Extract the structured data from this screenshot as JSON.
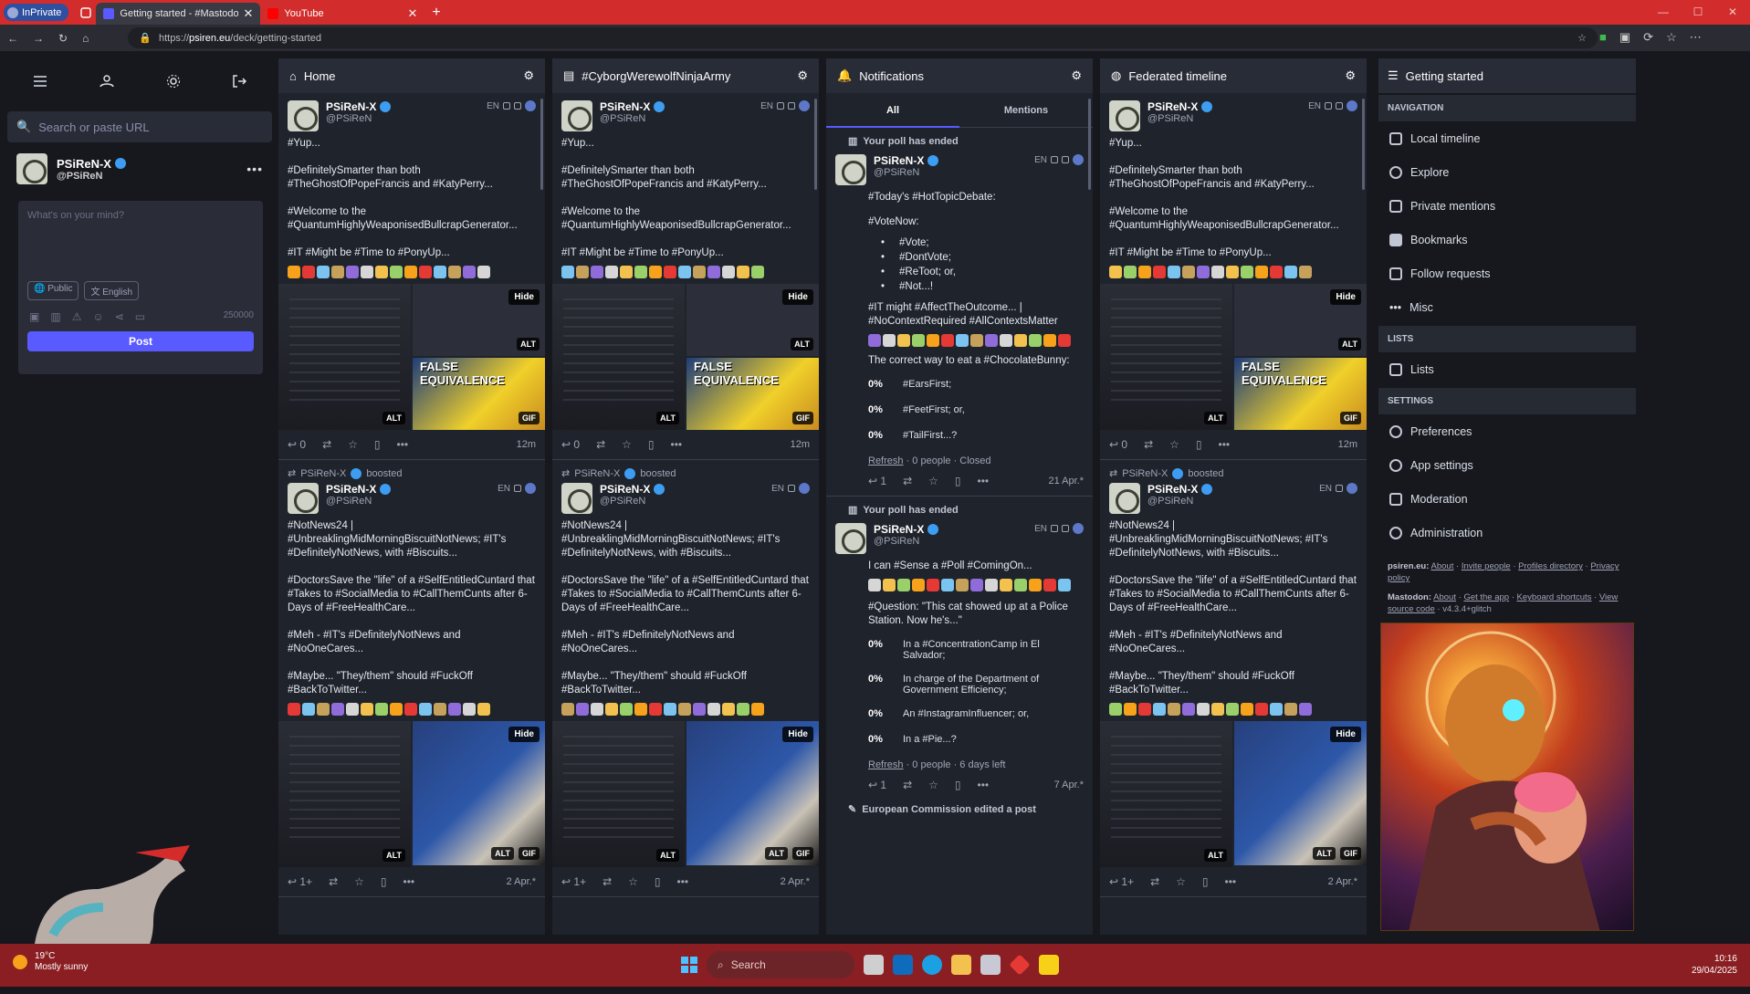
{
  "browser": {
    "inprivate": "InPrivate",
    "tabs": [
      {
        "title": "Getting started - #MastodonSpy",
        "active": true,
        "color": "#595aff"
      },
      {
        "title": "YouTube",
        "active": false,
        "color": "#ff0000"
      }
    ],
    "url_host": "psiren.eu",
    "url_prefix": "https://",
    "url_path": "/deck/getting-started"
  },
  "drawer": {
    "search_placeholder": "Search or paste URL",
    "account": {
      "name": "PSiReN-X",
      "acct": "@PSiReN"
    },
    "compose": {
      "placeholder": "What's on your mind?",
      "visibility": "Public",
      "language": "English",
      "counter": "250000",
      "post_label": "Post"
    }
  },
  "columns": [
    {
      "title": "Home",
      "icon": "home-icon"
    },
    {
      "title": "#CyborgWerewolfNinjaArmy",
      "icon": "hashtag-icon"
    },
    {
      "title": "Notifications",
      "icon": "bell-icon"
    },
    {
      "title": "Federated timeline",
      "icon": "globe-icon"
    }
  ],
  "status1": {
    "name": "PSiReN-X",
    "acct": "@PSiReN",
    "lang": "EN",
    "lines": [
      "#Yup...",
      "#DefinitelySmarter than both #TheGhostOfPopeFrancis and #KatyPerry...",
      "#Welcome to the #QuantumHighlyWeaponisedBullcrapGenerator...",
      "#IT #Might be #Time to #PonyUp..."
    ],
    "media_hide": "Hide",
    "alt": "ALT",
    "gif": "GIF",
    "meme_text": "FALSE EQUIVALENCE",
    "replies": "0",
    "time": "12m"
  },
  "boost": {
    "booster": "PSiReN-X",
    "label": "boosted"
  },
  "status2": {
    "name": "PSiReN-X",
    "acct": "@PSiReN",
    "lang": "EN",
    "lines": [
      "#NotNews24 | #UnbreaklingMidMorningBiscuitNotNews; #IT's #DefinitelyNotNews, with #Biscuits...",
      "#DoctorsSave the \"life\" of a #SelfEntitledCuntard that #Takes to #SocialMedia to #CallThemCunts after 6-Days of #FreeHealthCare...",
      "#Meh - #IT's #DefinitelyNotNews and #NoOneCares...",
      "#Maybe... \"They/them\" should #FuckOff #BackToTwitter..."
    ],
    "media_hide": "Hide",
    "alt": "ALT",
    "gif": "GIF",
    "replies": "1+",
    "time": "2 Apr.*"
  },
  "notifications": {
    "tabs": [
      "All",
      "Mentions"
    ],
    "n1": {
      "title": "Your poll has ended",
      "name": "PSiReN-X",
      "acct": "@PSiReN",
      "lang": "EN",
      "intro": "#Today's #HotTopicDebate:",
      "vote_now": "#VoteNow:",
      "bullets": [
        "#Vote;",
        "#DontVote;",
        "#ReToot; or,",
        "#Not...!"
      ],
      "extra": "#IT might #AffectTheOutcome... | #NoContextRequired #AllContextsMatter",
      "question": "The correct way to eat a #ChocolateBunny:",
      "options": [
        {
          "pct": "0%",
          "text": "#EarsFirst;"
        },
        {
          "pct": "0%",
          "text": "#FeetFirst; or,"
        },
        {
          "pct": "0%",
          "text": "#TailFirst...?"
        }
      ],
      "refresh": "Refresh",
      "foot": " · 0 people · Closed",
      "replies": "1",
      "time": "21 Apr.*"
    },
    "n2": {
      "title": "Your poll has ended",
      "name": "PSiReN-X",
      "acct": "@PSiReN",
      "lang": "EN",
      "intro": "I can #Sense a #Poll #ComingOn...",
      "question": "#Question: \"This cat showed up at a Police Station. Now he's...\"",
      "options": [
        {
          "pct": "0%",
          "text": "In a #ConcentrationCamp in El Salvador;"
        },
        {
          "pct": "0%",
          "text": "In charge of the Department of Government Efficiency;"
        },
        {
          "pct": "0%",
          "text": "An #InstagramInfluencer; or,"
        },
        {
          "pct": "0%",
          "text": "In a #Pie...?"
        }
      ],
      "refresh": "Refresh",
      "foot": " · 0 people · 6 days left",
      "replies": "1",
      "time": "7 Apr.*"
    },
    "n3_title": "European Commission edited a post"
  },
  "getting_started": {
    "title": "Getting started",
    "navigation_label": "NAVIGATION",
    "navigation": [
      "Local timeline",
      "Explore",
      "Private mentions",
      "Bookmarks",
      "Follow requests",
      "Misc"
    ],
    "lists_label": "LISTS",
    "lists": [
      "Lists"
    ],
    "settings_label": "SETTINGS",
    "settings": [
      "Preferences",
      "App settings",
      "Moderation",
      "Administration"
    ],
    "footer1": {
      "host": "psiren.eu:",
      "links": [
        "About",
        "Invite people",
        "Profiles directory",
        "Privacy policy"
      ]
    },
    "footer2": {
      "host": "Mastodon:",
      "links": [
        "About",
        "Get the app",
        "Keyboard shortcuts",
        "View source code"
      ],
      "version": "· v4.3.4+glitch"
    }
  },
  "taskbar": {
    "temp": "19°C",
    "weather": "Mostly sunny",
    "search": "Search",
    "time": "10:16",
    "date": "29/04/2025"
  },
  "colors": {
    "accent": "#595aff",
    "verified": "#3d9df2",
    "tabbar": "#d22c2c",
    "taskbar": "#8a1e22"
  }
}
